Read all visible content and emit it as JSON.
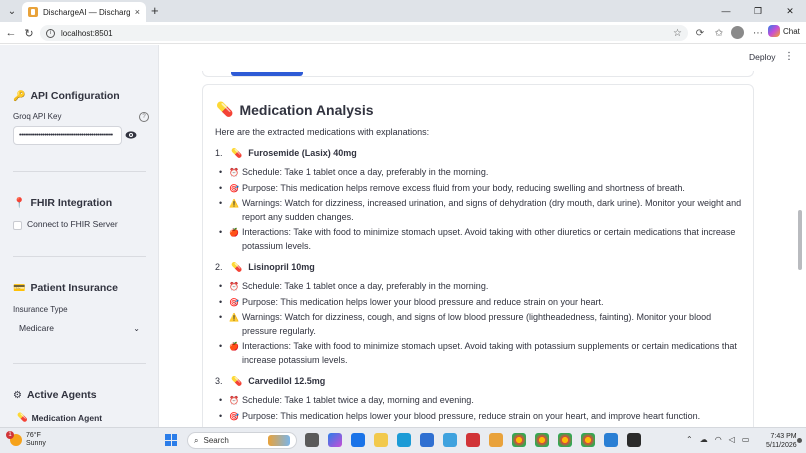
{
  "browser": {
    "tab_title": "DischargeAI — Discharge Planning",
    "tab_close": "×",
    "new_tab": "+",
    "url": "localhost:8501",
    "copilot_label": "Chat"
  },
  "app_header": {
    "deploy_label": "Deploy",
    "menu_glyph": "⋮"
  },
  "sidebar": {
    "api_config": {
      "icon": "key-icon",
      "icon_glyph": "🔑",
      "title": "API Configuration",
      "field_label": "Groq API Key",
      "help_glyph": "?",
      "masked_value": "••••••••••••••••••••••••••••••••••••••••••••••••"
    },
    "fhir": {
      "icon": "pin-icon",
      "icon_glyph": "📍",
      "title": "FHIR Integration",
      "checkbox_label": "Connect to FHIR Server"
    },
    "insurance": {
      "icon": "card-icon",
      "icon_glyph": "💳",
      "title": "Patient Insurance",
      "field_label": "Insurance Type",
      "selected": "Medicare",
      "chevron": "⌄"
    },
    "agents": {
      "icon": "gear-icon",
      "icon_glyph": "⚙",
      "title": "Active Agents",
      "items": [
        {
          "icon_glyph": "💊",
          "label": "Medication Agent"
        }
      ]
    }
  },
  "main": {
    "card_icon_glyph": "💊",
    "card_title": "Medication Analysis",
    "intro": "Here are the extracted medications with explanations:",
    "medications": [
      {
        "number": "1.",
        "icon_glyph": "💊",
        "name": "Furosemide (Lasix) 40mg",
        "details": [
          {
            "icon": "alarm-clock-icon",
            "glyph": "⏰",
            "text": "Schedule: Take 1 tablet once a day, preferably in the morning."
          },
          {
            "icon": "target-icon",
            "glyph": "🎯",
            "text": "Purpose: This medication helps remove excess fluid from your body, reducing swelling and shortness of breath."
          },
          {
            "icon": "warning-icon",
            "glyph": "⚠️",
            "text": "Warnings: Watch for dizziness, increased urination, and signs of dehydration (dry mouth, dark urine). Monitor your weight and report any sudden changes."
          },
          {
            "icon": "apple-icon",
            "glyph": "🍎",
            "text": "Interactions: Take with food to minimize stomach upset. Avoid taking with other diuretics or certain medications that increase potassium levels."
          }
        ]
      },
      {
        "number": "2.",
        "icon_glyph": "💊",
        "name": "Lisinopril 10mg",
        "details": [
          {
            "icon": "alarm-clock-icon",
            "glyph": "⏰",
            "text": "Schedule: Take 1 tablet once a day, preferably in the morning."
          },
          {
            "icon": "target-icon",
            "glyph": "🎯",
            "text": "Purpose: This medication helps lower your blood pressure and reduce strain on your heart."
          },
          {
            "icon": "warning-icon",
            "glyph": "⚠️",
            "text": "Warnings: Watch for dizziness, cough, and signs of low blood pressure (lightheadedness, fainting). Monitor your blood pressure regularly."
          },
          {
            "icon": "apple-icon",
            "glyph": "🍎",
            "text": "Interactions: Take with food to minimize stomach upset. Avoid taking with potassium supplements or certain medications that increase potassium levels."
          }
        ]
      },
      {
        "number": "3.",
        "icon_glyph": "💊",
        "name": "Carvedilol 12.5mg",
        "details": [
          {
            "icon": "alarm-clock-icon",
            "glyph": "⏰",
            "text": "Schedule: Take 1 tablet twice a day, morning and evening."
          },
          {
            "icon": "target-icon",
            "glyph": "🎯",
            "text": "Purpose: This medication helps lower your blood pressure, reduce strain on your heart, and improve heart function."
          }
        ]
      }
    ]
  },
  "taskbar": {
    "weather_badge": "1",
    "temperature": "76°F",
    "condition": "Sunny",
    "search_placeholder": "Search",
    "time": "7:43 PM",
    "date": "5/11/2026"
  }
}
